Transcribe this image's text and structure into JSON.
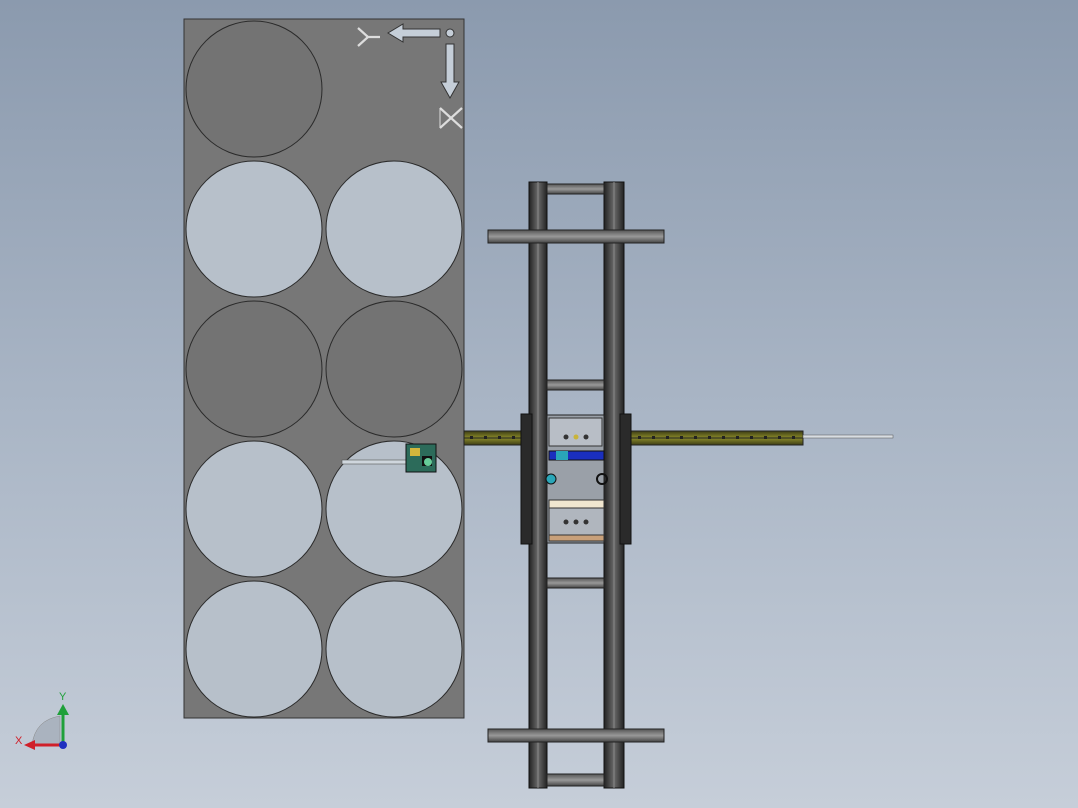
{
  "viewport": {
    "background_top": "#8b9aae",
    "background_bottom": "#c6ced9"
  },
  "plate": {
    "color": "#777777",
    "direction_labels": {
      "y": "Y",
      "x": "X"
    },
    "cells": [
      {
        "row": 1,
        "col": 1,
        "state": "filled"
      },
      {
        "row": 1,
        "col": 2,
        "state": "absent"
      },
      {
        "row": 2,
        "col": 1,
        "state": "empty"
      },
      {
        "row": 2,
        "col": 2,
        "state": "empty"
      },
      {
        "row": 3,
        "col": 1,
        "state": "filled"
      },
      {
        "row": 3,
        "col": 2,
        "state": "filled"
      },
      {
        "row": 4,
        "col": 1,
        "state": "empty"
      },
      {
        "row": 4,
        "col": 2,
        "state": "empty"
      },
      {
        "row": 5,
        "col": 1,
        "state": "empty"
      },
      {
        "row": 5,
        "col": 2,
        "state": "empty"
      }
    ],
    "filled_color": "#737373",
    "empty_color": "#b7c0ca"
  },
  "gantry": {
    "frame_color": "#2a2a2a",
    "rail_color": "#5a5a1e"
  },
  "triad": {
    "x_label": "X",
    "y_label": "Y",
    "x_color": "#d0202a",
    "y_color": "#1fa03a",
    "z_color": "#2030c0"
  }
}
